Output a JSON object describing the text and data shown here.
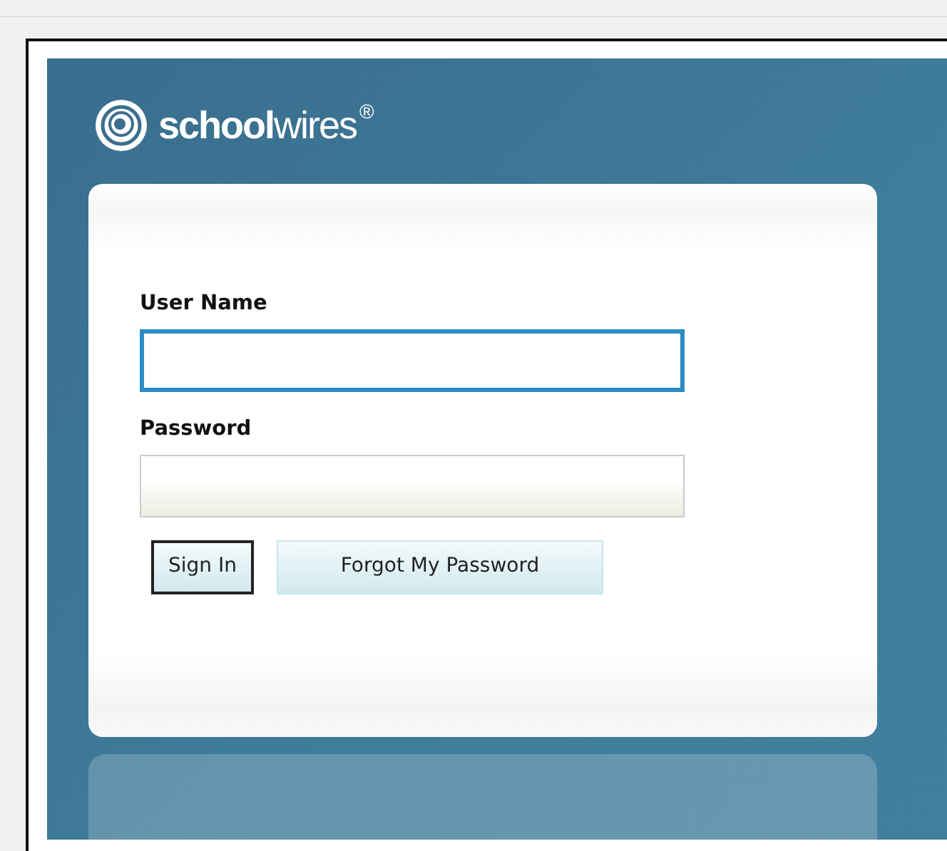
{
  "logo": {
    "text": "**school**wires$^{®}$"
  },
  "form": {
    "fields": [
      {
        "label": "User Name",
        "focused": true
      },
      {
        "label": "Password",
        "focused": false
      }
    ],
    "buttons": [
      {
        "label": "Sign In",
        "kind": "primary"
      },
      {
        "label": "Forgot My Password",
        "kind": "link"
      }
    ]
  }
}
